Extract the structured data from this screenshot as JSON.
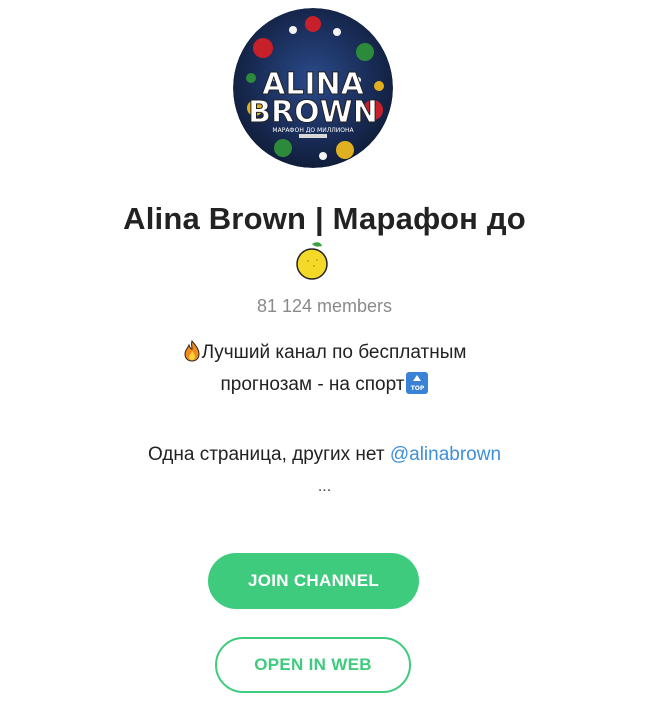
{
  "channel": {
    "title": "Alina Brown | Марафон до",
    "members": "81 124 members",
    "description_line1": "Лучший канал по бесплатным",
    "description_line2": "прогнозам - на спорт",
    "description_line3_text": "Одна страница, других нет ",
    "description_line3_link": "@alinabrown",
    "description_more": "...",
    "avatar_text": {
      "line1": "ALINA",
      "line2": "BROWN",
      "subtitle": "МАРАФОН ДО МИЛЛИОНА"
    }
  },
  "buttons": {
    "join_label": "JOIN CHANNEL",
    "web_label": "OPEN IN WEB"
  },
  "icons": {
    "lemon": "lemon-icon",
    "fire": "fire-icon",
    "top": "top-arrow-icon"
  },
  "colors": {
    "accent_green": "#3ecb7d",
    "link_blue": "#3e8fd8",
    "title_text": "#222222",
    "muted_text": "#8a8a8a"
  }
}
